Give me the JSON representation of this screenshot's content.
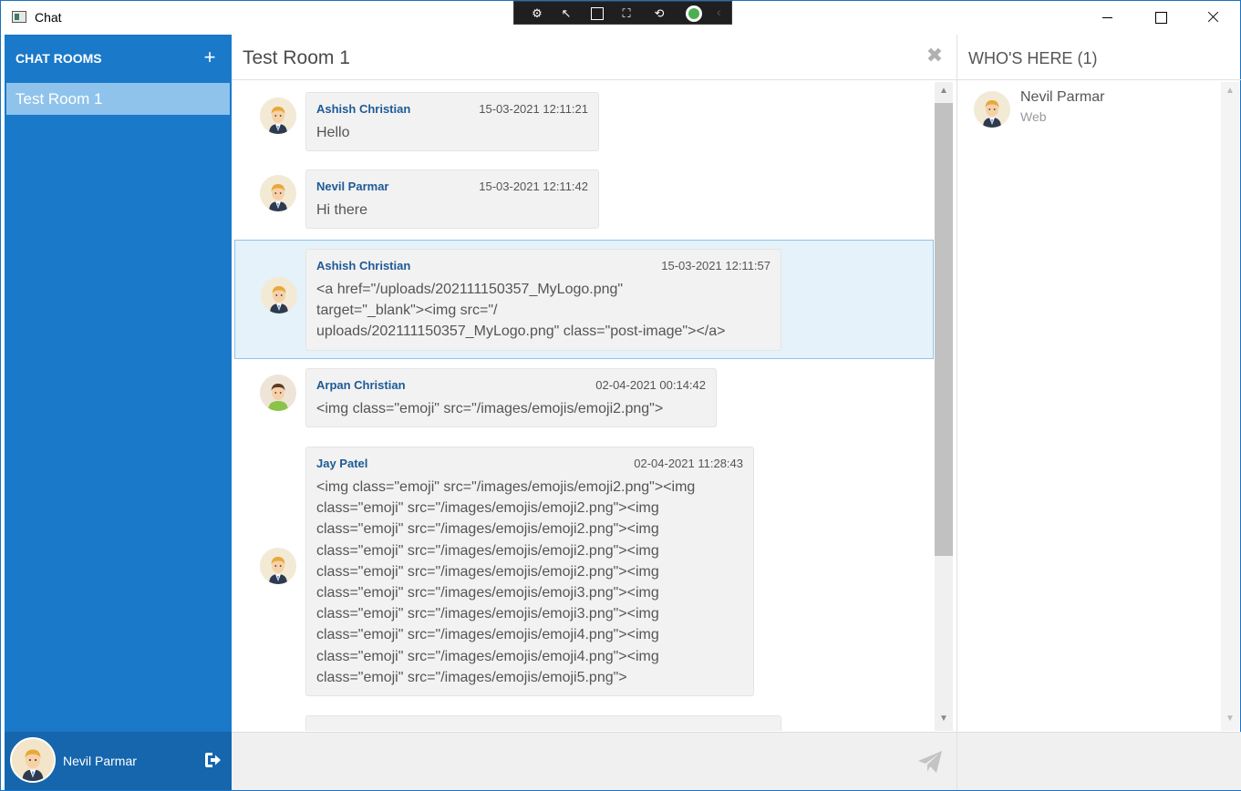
{
  "window": {
    "title": "Chat"
  },
  "sidebar": {
    "title": "CHAT ROOMS",
    "add_label": "+",
    "rooms": [
      {
        "label": "Test Room 1"
      }
    ],
    "current_user": "Nevil Parmar"
  },
  "main": {
    "room_title": "Test Room 1",
    "close_label": "✖",
    "messages": [
      {
        "sender": "Ashish Christian",
        "time": "15-03-2021 12:11:21",
        "body": "Hello",
        "avatar": "male-avatar-blond"
      },
      {
        "sender": "Nevil Parmar",
        "time": "15-03-2021 12:11:42",
        "body": "Hi there",
        "avatar": "male-avatar-blond"
      },
      {
        "sender": "Ashish Christian",
        "time": "15-03-2021 12:11:57",
        "body": "<a href=\"/uploads/202111150357_MyLogo.png\"\ntarget=\"_blank\"><img src=\"/\nuploads/202111150357_MyLogo.png\" class=\"post-image\"></a>",
        "avatar": "male-avatar-blond",
        "selected": true
      },
      {
        "sender": "Arpan Christian",
        "time": "02-04-2021 00:14:42",
        "body": "<img class=\"emoji\" src=\"/images/emojis/emoji2.png\">",
        "avatar": "male-avatar-dark-hair"
      },
      {
        "sender": "Jay Patel",
        "time": "02-04-2021 11:28:43",
        "body": "<img class=\"emoji\" src=\"/images/emojis/emoji2.png\"><img\nclass=\"emoji\" src=\"/images/emojis/emoji2.png\"><img\nclass=\"emoji\" src=\"/images/emojis/emoji2.png\"><img\nclass=\"emoji\" src=\"/images/emojis/emoji2.png\"><img\nclass=\"emoji\" src=\"/images/emojis/emoji2.png\"><img\nclass=\"emoji\" src=\"/images/emojis/emoji3.png\"><img\nclass=\"emoji\" src=\"/images/emojis/emoji3.png\"><img\nclass=\"emoji\" src=\"/images/emojis/emoji4.png\"><img\nclass=\"emoji\" src=\"/images/emojis/emoji4.png\"><img\nclass=\"emoji\" src=\"/images/emojis/emoji5.png\">",
        "avatar": "male-avatar-blond"
      }
    ],
    "input_value": "",
    "send_icon": "send-paper-plane-icon"
  },
  "who": {
    "title": "WHO'S HERE (1)",
    "users": [
      {
        "name": "Nevil Parmar",
        "client": "Web"
      }
    ]
  },
  "colors": {
    "sidebar": "#1a79c9",
    "sidebar_footer": "#1566ad",
    "room_selected": "#8fc3ec",
    "sender": "#1e5a96",
    "selected_message": "#e5f2fa"
  }
}
